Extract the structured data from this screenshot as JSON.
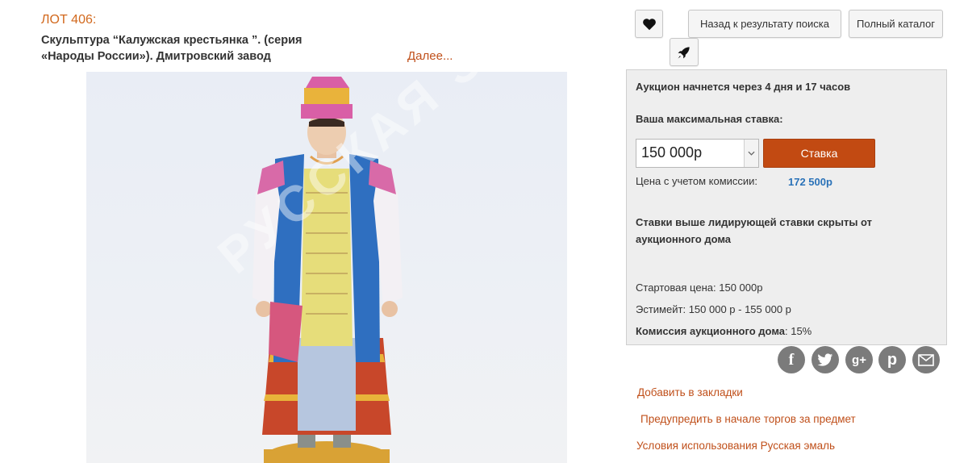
{
  "lot": {
    "number": "ЛОТ 406:",
    "title_line1": "Скульптура “Калужская крестьянка ”. (серия",
    "title_line2": "«Народы России»). Дмитровский завод",
    "more": "Далее..."
  },
  "photo": {
    "watermark": "РУССКАЯ ЭМАЛЬ"
  },
  "nav": {
    "favorite_icon": "heart-icon",
    "back_label": "Назад к результату поиска",
    "catalog_label": "Полный каталог",
    "rocket_icon": "rocket-icon"
  },
  "auction": {
    "start_notice": "Аукцион начнется через 4 дня и 17 часов",
    "max_bid_label": "Ваша максимальная ставка:",
    "bid_value": "150 000р",
    "bid_button": "Ставка",
    "commission_price_label": "Цена с учетом комиссии:",
    "commission_price_value": "172 500р",
    "hidden_notice_line1": "Ставки выше лидирующей ставки скрыты от",
    "hidden_notice_line2": "аукционного дома",
    "start_price_label": "Стартовая цена:",
    "start_price_value": "150 000р",
    "estimate_label": "Эстимейт:",
    "estimate_value": "150 000 р - 155 000 р",
    "house_commission_label": "Комиссия аукционного дома",
    "house_commission_value": ": 15%"
  },
  "share": [
    {
      "icon": "facebook-icon",
      "glyph": "f"
    },
    {
      "icon": "twitter-icon",
      "glyph": ""
    },
    {
      "icon": "google-plus-icon",
      "glyph": "g+"
    },
    {
      "icon": "pinterest-icon",
      "glyph": "p"
    },
    {
      "icon": "email-icon",
      "glyph": ""
    }
  ],
  "links": {
    "bookmark": "Добавить в закладки",
    "notify": "Предупредить в начале торгов за предмет",
    "terms": "Условия использования Русская эмаль"
  },
  "colors": {
    "accent": "#c24a12",
    "link": "#c0501b",
    "commission": "#2a72b8",
    "panel_bg": "#eeeeee"
  }
}
